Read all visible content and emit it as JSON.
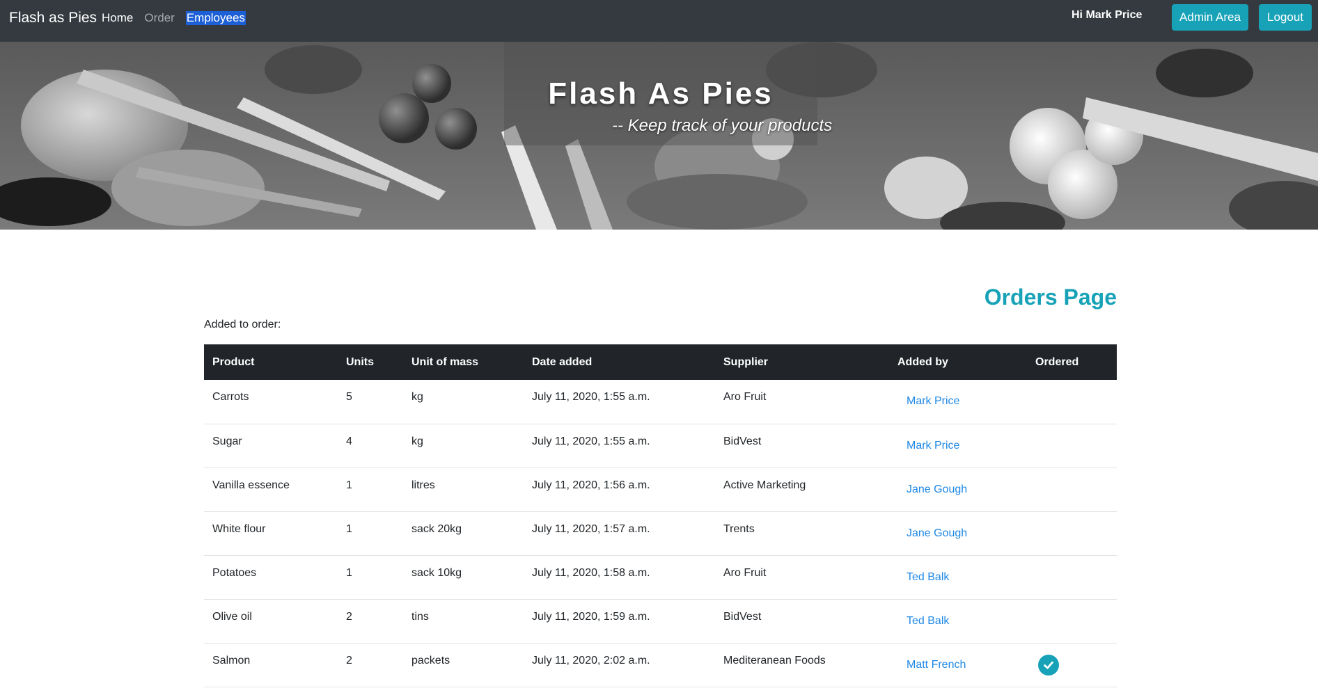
{
  "navbar": {
    "brand": "Flash as Pies",
    "links": [
      {
        "label": "Home"
      },
      {
        "label": "Order"
      },
      {
        "label": "Employees"
      }
    ],
    "greeting": "Hi Mark Price",
    "admin_button": "Admin Area",
    "logout_button": "Logout"
  },
  "hero": {
    "title": "Flash As Pies",
    "tagline": "-- Keep track of your products"
  },
  "main": {
    "heading": "Orders Page",
    "added_label": "Added to order:",
    "accent_color": "#17a2b8",
    "table": {
      "headers": [
        "Product",
        "Units",
        "Unit of mass",
        "Date added",
        "Supplier",
        "Added by",
        "Ordered"
      ],
      "rows": [
        {
          "product": "Carrots",
          "units": "5",
          "unit_of_mass": "kg",
          "date_added": "July 11, 2020, 1:55 a.m.",
          "supplier": "Aro Fruit",
          "added_by": "Mark Price",
          "ordered": false
        },
        {
          "product": "Sugar",
          "units": "4",
          "unit_of_mass": "kg",
          "date_added": "July 11, 2020, 1:55 a.m.",
          "supplier": "BidVest",
          "added_by": "Mark Price",
          "ordered": false
        },
        {
          "product": "Vanilla essence",
          "units": "1",
          "unit_of_mass": "litres",
          "date_added": "July 11, 2020, 1:56 a.m.",
          "supplier": "Active Marketing",
          "added_by": "Jane Gough",
          "ordered": false
        },
        {
          "product": "White flour",
          "units": "1",
          "unit_of_mass": "sack 20kg",
          "date_added": "July 11, 2020, 1:57 a.m.",
          "supplier": "Trents",
          "added_by": "Jane Gough",
          "ordered": false
        },
        {
          "product": "Potatoes",
          "units": "1",
          "unit_of_mass": "sack 10kg",
          "date_added": "July 11, 2020, 1:58 a.m.",
          "supplier": "Aro Fruit",
          "added_by": "Ted Balk",
          "ordered": false
        },
        {
          "product": "Olive oil",
          "units": "2",
          "unit_of_mass": "tins",
          "date_added": "July 11, 2020, 1:59 a.m.",
          "supplier": "BidVest",
          "added_by": "Ted Balk",
          "ordered": false
        },
        {
          "product": "Salmon",
          "units": "2",
          "unit_of_mass": "packets",
          "date_added": "July 11, 2020, 2:02 a.m.",
          "supplier": "Mediteranean Foods",
          "added_by": "Matt French",
          "ordered": true
        }
      ]
    }
  }
}
